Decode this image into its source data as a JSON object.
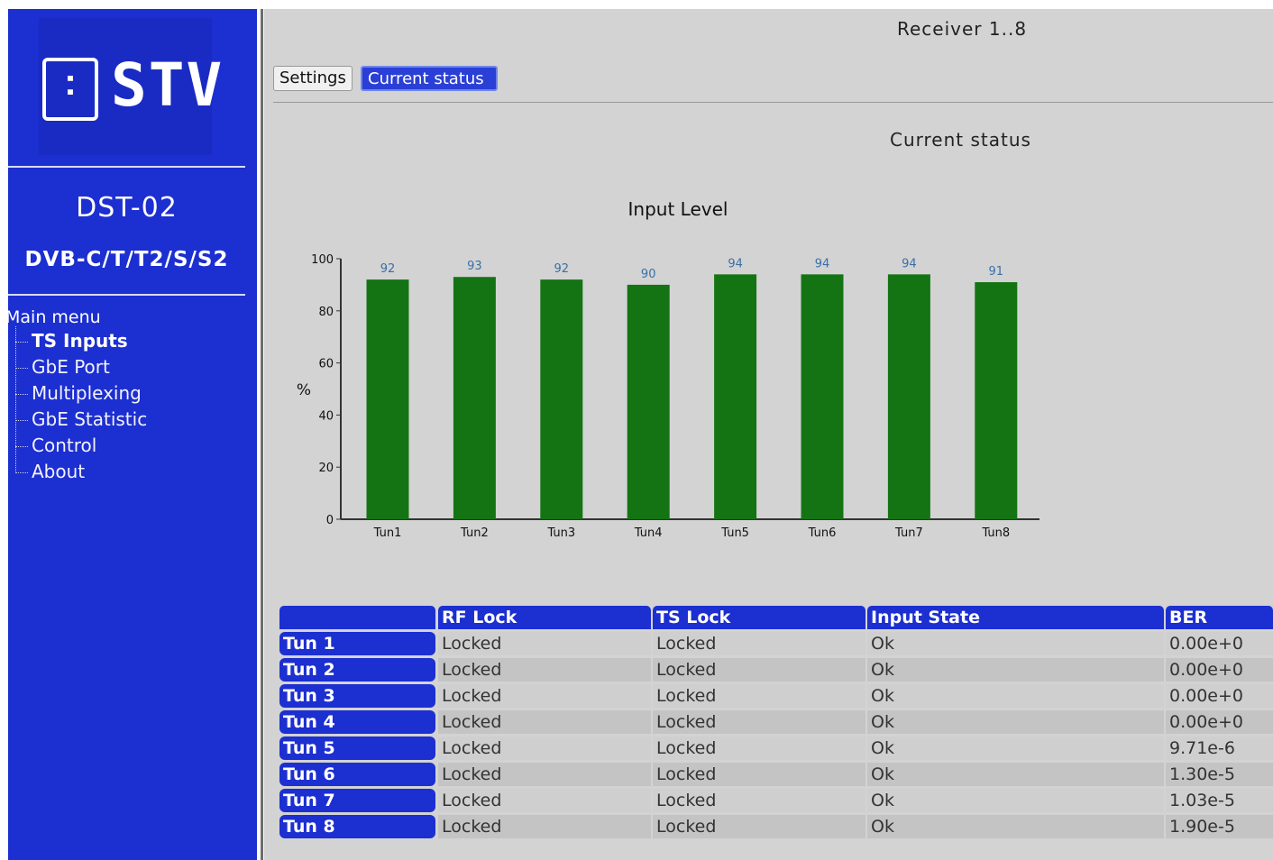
{
  "sidebar": {
    "logo_text": "STV",
    "model": "DST-02",
    "standard": "DVB-C/T/T2/S/S2",
    "menu_title": "Main menu",
    "menu_items": [
      "TS Inputs",
      "GbE Port",
      "Multiplexing",
      "GbE Statistic",
      "Control",
      "About"
    ]
  },
  "header": {
    "title": "Receiver 1..8"
  },
  "tabs": [
    "Settings",
    "Current status"
  ],
  "section_title": "Current status",
  "chart_data": {
    "type": "bar",
    "title": "Input Level",
    "ylabel": "%",
    "xlabel": "",
    "categories": [
      "Tun1",
      "Tun2",
      "Tun3",
      "Tun4",
      "Tun5",
      "Tun6",
      "Tun7",
      "Tun8"
    ],
    "values": [
      92,
      93,
      92,
      90,
      94,
      94,
      94,
      91
    ],
    "ylim": [
      0,
      100
    ],
    "yticks": [
      0,
      20,
      40,
      60,
      80,
      100
    ],
    "bar_color": "#147414",
    "label_color": "#3a6fa8"
  },
  "table": {
    "columns": [
      "",
      "RF Lock",
      "TS Lock",
      "Input State",
      "BER"
    ],
    "rows": [
      [
        "Tun 1",
        "Locked",
        "Locked",
        "Ok",
        "0.00e+0"
      ],
      [
        "Tun 2",
        "Locked",
        "Locked",
        "Ok",
        "0.00e+0"
      ],
      [
        "Tun 3",
        "Locked",
        "Locked",
        "Ok",
        "0.00e+0"
      ],
      [
        "Tun 4",
        "Locked",
        "Locked",
        "Ok",
        "0.00e+0"
      ],
      [
        "Tun 5",
        "Locked",
        "Locked",
        "Ok",
        "9.71e-6"
      ],
      [
        "Tun 6",
        "Locked",
        "Locked",
        "Ok",
        "1.30e-5"
      ],
      [
        "Tun 7",
        "Locked",
        "Locked",
        "Ok",
        "1.03e-5"
      ],
      [
        "Tun 8",
        "Locked",
        "Locked",
        "Ok",
        "1.90e-5"
      ]
    ]
  }
}
